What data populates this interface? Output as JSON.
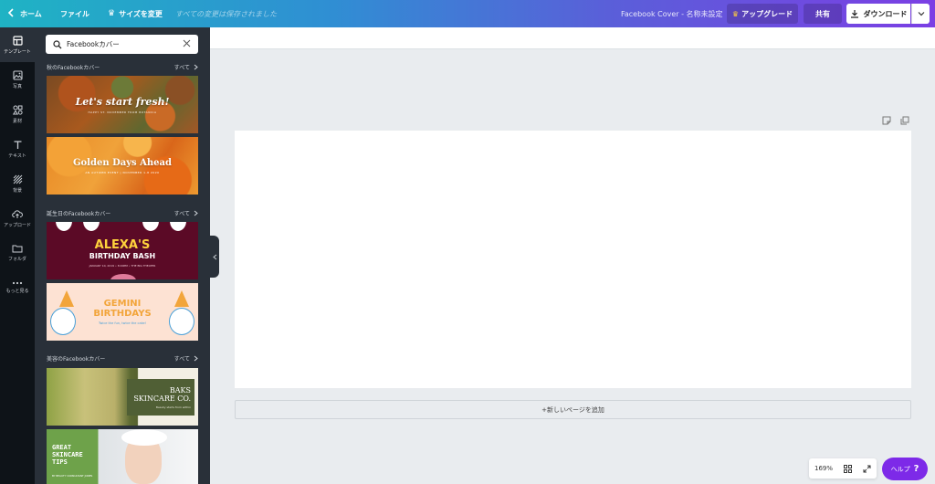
{
  "topbar": {
    "home_label": "ホーム",
    "file_label": "ファイル",
    "resize_label": "サイズを変更",
    "save_status": "すべての変更は保存されました",
    "doc_title": "Facebook Cover - 名称未設定",
    "upgrade_label": "アップグレード",
    "share_label": "共有",
    "download_label": "ダウンロード"
  },
  "sidebar": {
    "items": [
      {
        "label": "テンプレート",
        "icon": "template-icon"
      },
      {
        "label": "写真",
        "icon": "photo-icon"
      },
      {
        "label": "素材",
        "icon": "elements-icon"
      },
      {
        "label": "テキスト",
        "icon": "text-icon"
      },
      {
        "label": "背景",
        "icon": "background-icon"
      },
      {
        "label": "アップロード",
        "icon": "upload-icon"
      },
      {
        "label": "フォルダ",
        "icon": "folder-icon"
      },
      {
        "label": "もっと見る",
        "icon": "more-icon"
      }
    ]
  },
  "panel": {
    "search_value": "Facebookカバー",
    "sections": [
      {
        "title": "秋のFacebookカバー",
        "see_all": "すべて"
      },
      {
        "title": "誕生日のFacebookカバー",
        "see_all": "すべて"
      },
      {
        "title": "美容のFacebookカバー",
        "see_all": "すべて"
      }
    ],
    "templates": {
      "t1_title": "Let's start fresh!",
      "t1_sub": "HAPPY ST. NOVEMBER FROM BOTANICA",
      "t2_title": "Golden Days Ahead",
      "t2_sub": "AN AUTUMN EVENT | NOVEMBER 1-8 2020",
      "t3_title": "ALEXA'S",
      "t3_sub": "BIRTHDAY BASH",
      "t3_small": "JANUARY 10, 2019 • 8:00PM • THE BIG THEATER",
      "t4_title": "GEMINI\nBIRTHDAYS",
      "t4_sub": "Twice the fun, twice the cake!",
      "t5_title": "BAKS\nSKINCARE CO.",
      "t5_sub": "Beauty starts from within",
      "t6_title": "GREAT\nSKINCARE\nTIPS",
      "t6_sub": "BY BEAUTY CONSULTANT JONES"
    }
  },
  "canvas": {
    "add_page_label": "+新しいページを追加"
  },
  "bottom": {
    "zoom": "169%",
    "help_label": "ヘルプ",
    "help_mark": "?"
  },
  "colors": {
    "accent": "#7d2ae8",
    "sidebar_bg": "#0e1318",
    "panel_bg": "#293039"
  }
}
